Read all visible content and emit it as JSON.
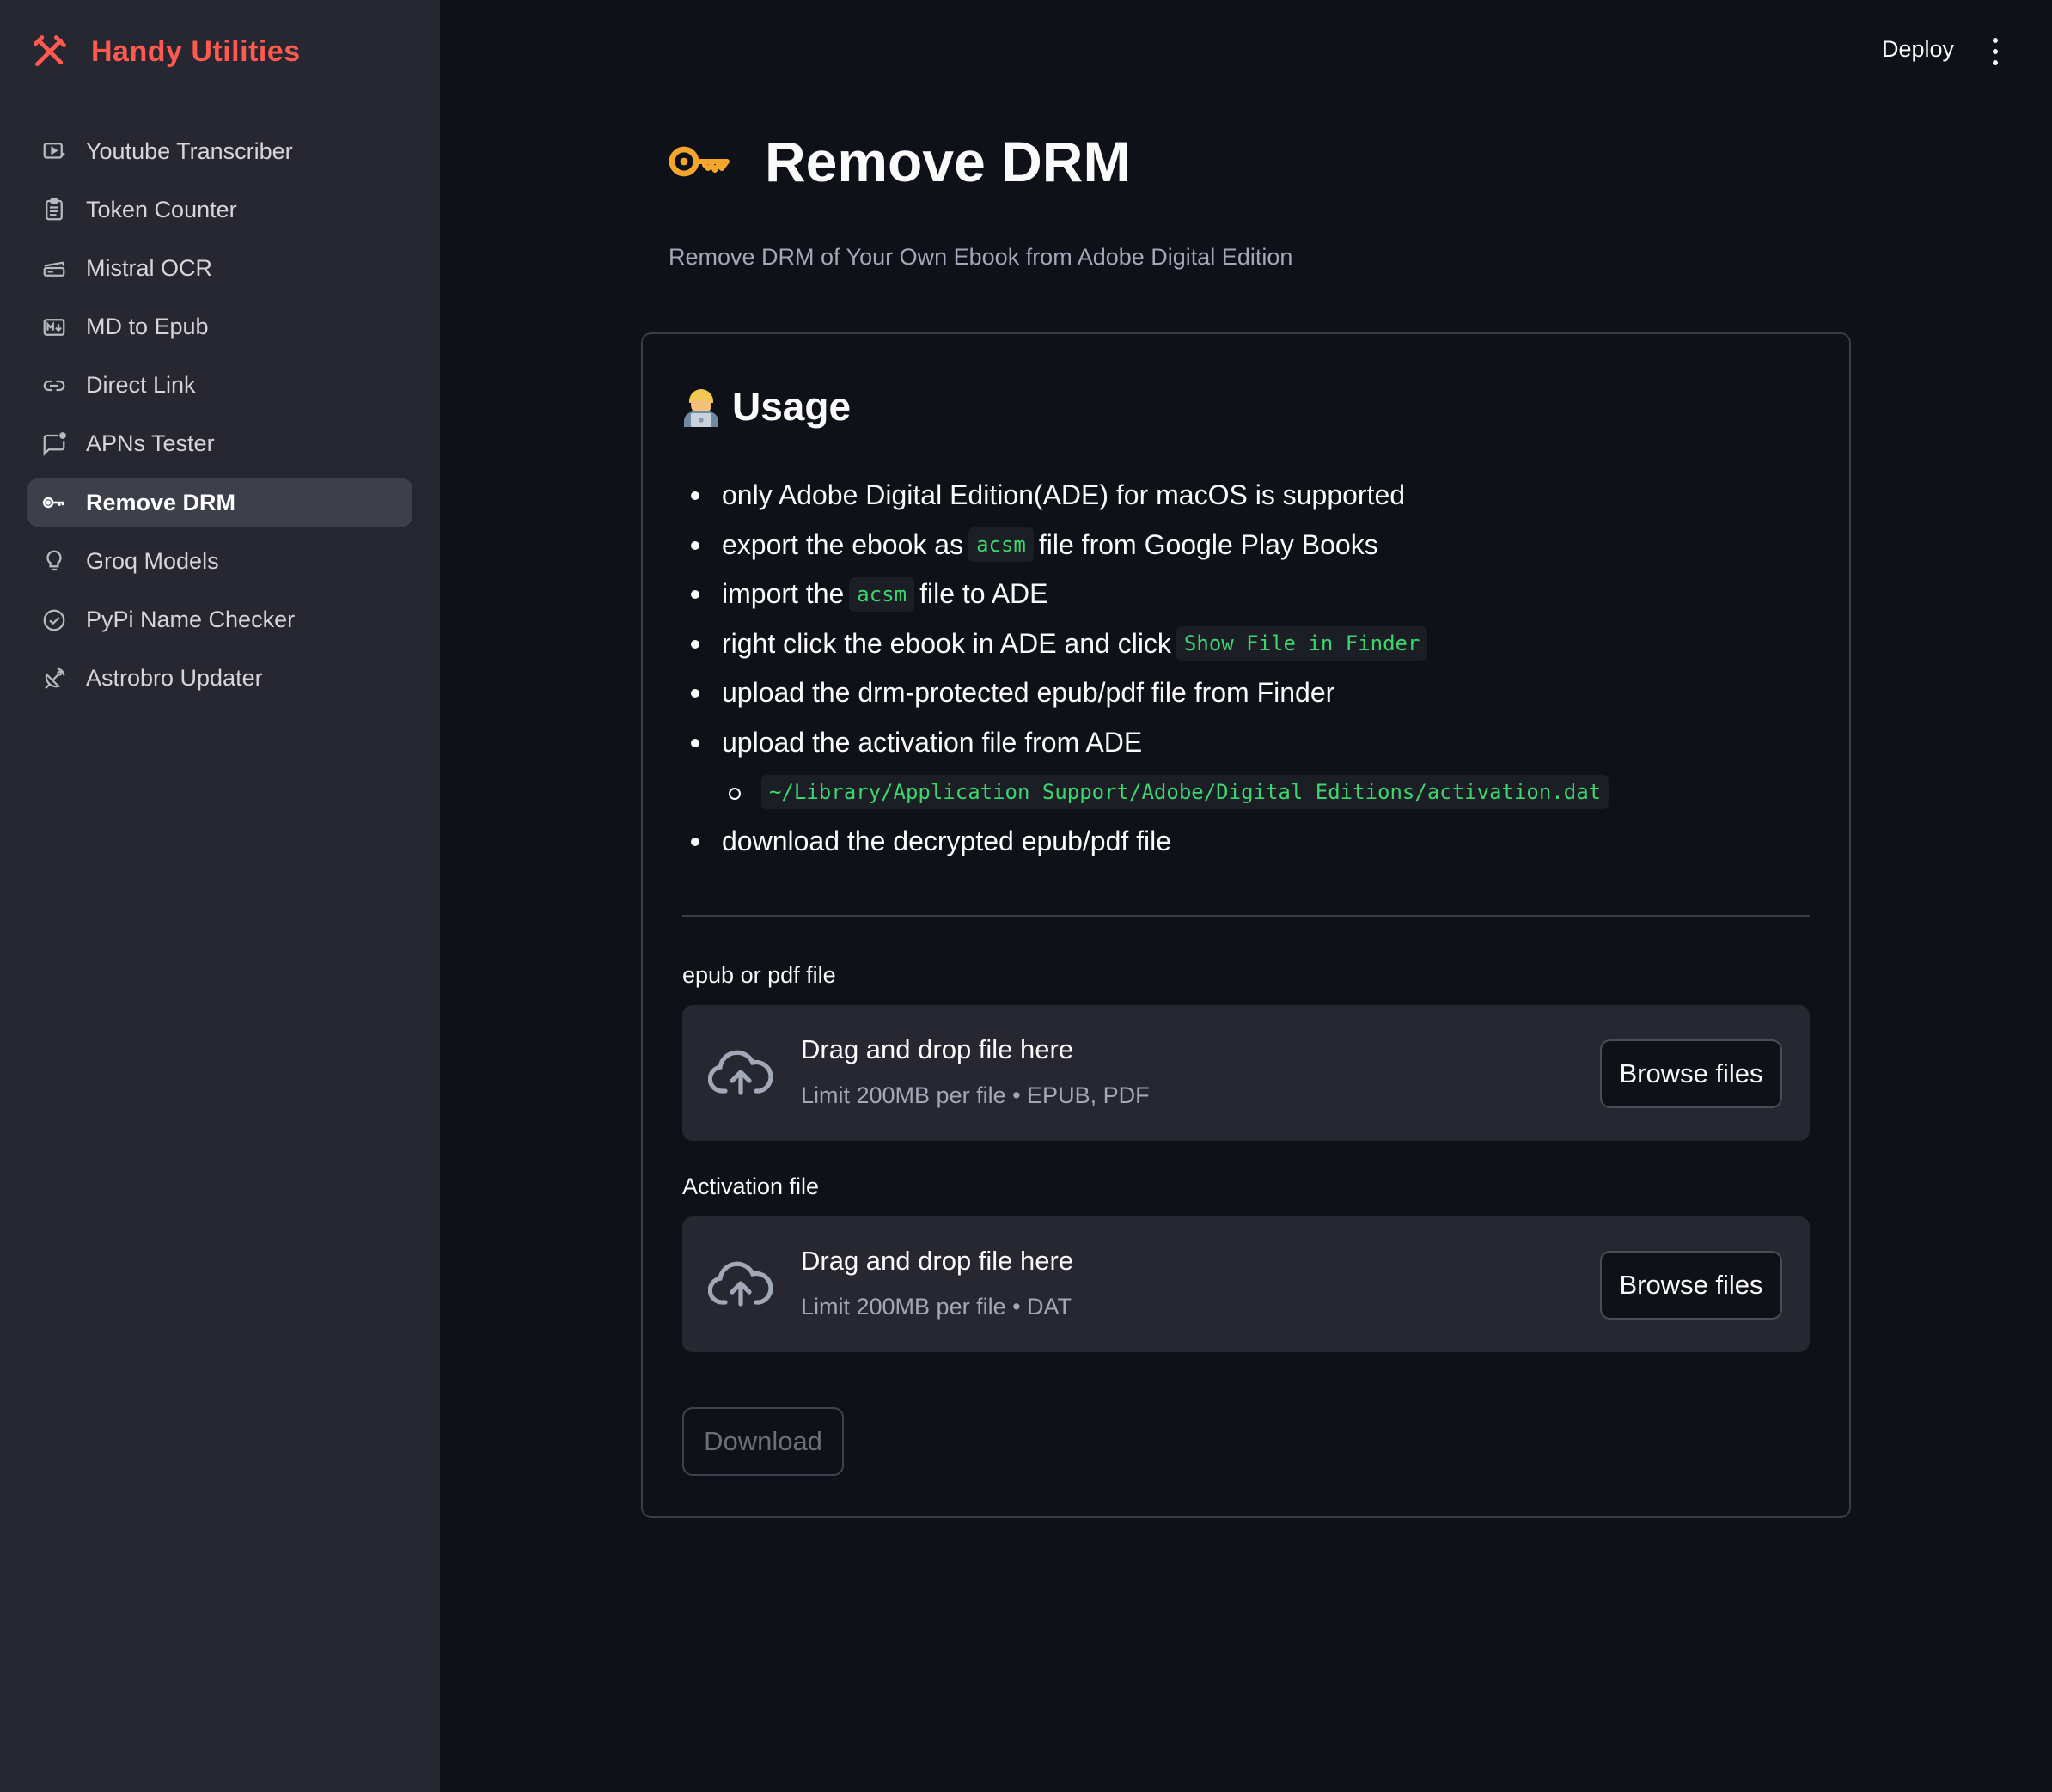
{
  "app": {
    "name": "Handy Utilities",
    "brand_color": "#ff5a4f",
    "brand_icon": "tools-icon"
  },
  "sidebar": {
    "items": [
      {
        "label": "Youtube Transcriber",
        "icon": "video-icon",
        "active": false
      },
      {
        "label": "Token Counter",
        "icon": "clipboard-icon",
        "active": false
      },
      {
        "label": "Mistral OCR",
        "icon": "scanner-icon",
        "active": false
      },
      {
        "label": "MD to Epub",
        "icon": "markdown-icon",
        "active": false
      },
      {
        "label": "Direct Link",
        "icon": "link-icon",
        "active": false
      },
      {
        "label": "APNs Tester",
        "icon": "notification-icon",
        "active": false
      },
      {
        "label": "Remove DRM",
        "icon": "key-icon",
        "active": true
      },
      {
        "label": "Groq Models",
        "icon": "lightbulb-icon",
        "active": false
      },
      {
        "label": "PyPi Name Checker",
        "icon": "check-circle-icon",
        "active": false
      },
      {
        "label": "Astrobro Updater",
        "icon": "satellite-icon",
        "active": false
      }
    ]
  },
  "header": {
    "deploy_label": "Deploy",
    "menu_icon": "kebab-menu-icon"
  },
  "main": {
    "title": "Remove DRM",
    "title_icon": "key-icon",
    "subtitle": "Remove DRM of Your Own Ebook from Adobe Digital Edition",
    "usage": {
      "heading": "Usage",
      "heading_icon": "technologist-emoji",
      "steps": [
        {
          "text": "only Adobe Digital Edition(ADE) for macOS is supported"
        },
        {
          "pre": "export the ebook as",
          "code": "acsm",
          "post": "file from Google Play Books"
        },
        {
          "pre": "import the",
          "code": "acsm",
          "post": "file to ADE"
        },
        {
          "pre": "right click the ebook in ADE and click",
          "code": "Show File in Finder"
        },
        {
          "text": "upload the drm-protected epub/pdf file from Finder"
        },
        {
          "text": "upload the activation file from ADE"
        },
        {
          "code": "~/Library/Application Support/Adobe/Digital Editions/activation.dat"
        },
        {
          "text": "download the decrypted epub/pdf file"
        }
      ]
    },
    "uploaders": [
      {
        "label": "epub or pdf file",
        "drop_text": "Drag and drop file here",
        "limit_text": "Limit 200MB per file • EPUB, PDF",
        "browse_label": "Browse files"
      },
      {
        "label": "Activation file",
        "drop_text": "Drag and drop file here",
        "limit_text": "Limit 200MB per file • DAT",
        "browse_label": "Browse files"
      }
    ],
    "download_label": "Download"
  }
}
